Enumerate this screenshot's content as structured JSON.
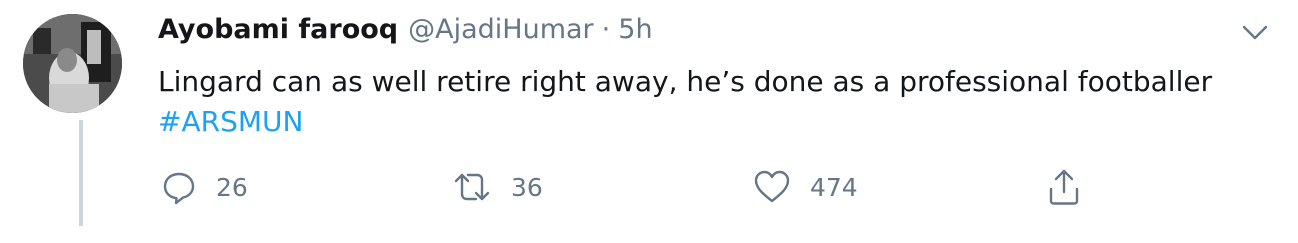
{
  "tweet": {
    "display_name": "Ayobami farooq",
    "handle": "@AjadiHumar",
    "separator": "·",
    "time": "5h",
    "text": "Lingard can as well retire right away, he’s done as a professional footballer",
    "hashtag": "#ARSMUN"
  },
  "actions": {
    "reply_count": "26",
    "retweet_count": "36",
    "like_count": "474"
  },
  "icons": {
    "reply": "reply-icon",
    "retweet": "retweet-icon",
    "like": "heart-icon",
    "share": "share-icon",
    "more": "chevron-down-icon"
  },
  "colors": {
    "text": "#14171a",
    "secondary": "#657786",
    "link": "#1da1f2",
    "thread_line": "#ccd6dd"
  }
}
